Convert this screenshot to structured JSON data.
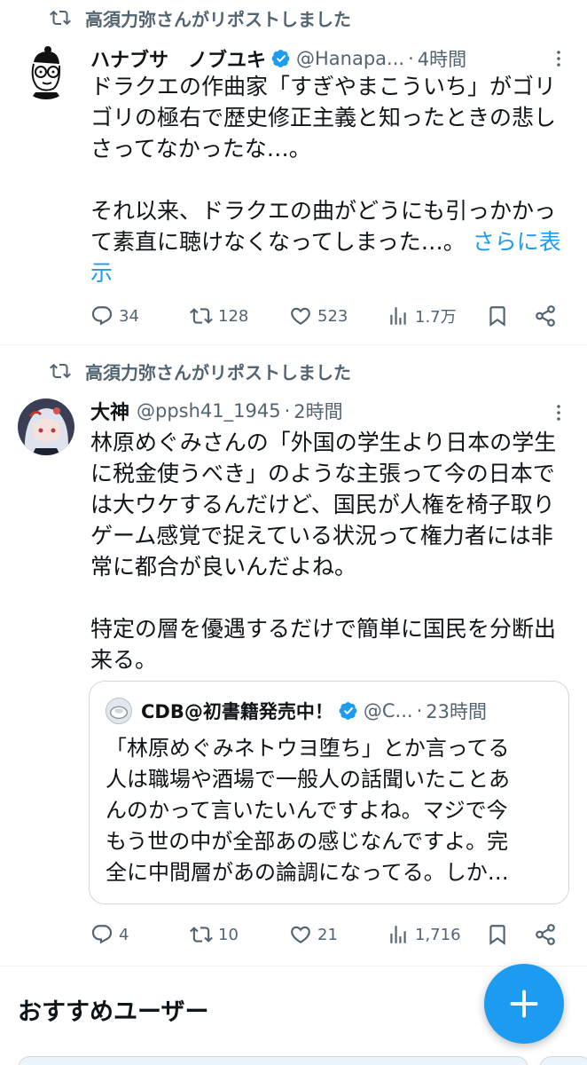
{
  "tweets": [
    {
      "repost_label": "高須力弥さんがリポストしました",
      "name": "ハナブサ　ノブユキ",
      "handle": "@Hanapa...",
      "separator": "·",
      "time": "4時間",
      "body_lines": [
        "ドラクエの作曲家「すぎやまこういち」がゴリ",
        "ゴリの極右で歴史修正主義と知ったときの悲し",
        "さってなかったな…。",
        "",
        "それ以来、ドラクエの曲がどうにも引っかかっ",
        "て素直に聴けなくなってしまった…。"
      ],
      "show_more_part1": "さらに表",
      "show_more_part2": "示",
      "replies": "34",
      "reposts": "128",
      "likes": "523",
      "views": "1.7万"
    },
    {
      "repost_label": "高須力弥さんがリポストしました",
      "name": "大神",
      "handle": "@ppsh41_1945",
      "separator": "·",
      "time": "2時間",
      "body_lines": [
        "林原めぐみさんの「外国の学生より日本の学生",
        "に税金使うべき」のような主張って今の日本で",
        "は大ウケするんだけど、国民が人権を椅子取り",
        "ゲーム感覚で捉えている状況って権力者には非",
        "常に都合が良いんだよね。",
        "",
        "特定の層を優遇するだけで簡単に国民を分断出",
        "来る。"
      ],
      "quote": {
        "name": "CDB@初書籍発売中！",
        "handle": "@C...",
        "separator": "·",
        "time": "23時間",
        "body_lines": [
          "「林原めぐみネトウヨ堕ち」とか言ってる",
          "人は職場や酒場で一般人の話聞いたことあ",
          "んのかって言いたいんですよね。マジで今",
          "もう世の中が全部あの感じなんですよ。完",
          "全に中間層があの論調になってる。しか…"
        ]
      },
      "replies": "4",
      "reposts": "10",
      "likes": "21",
      "views": "1,716"
    }
  ],
  "recommended_title": "おすすめユーザー",
  "fab_icon": "plus-icon",
  "colors": {
    "accent": "#1d9bf0",
    "secondary_text": "#536471",
    "primary_text": "#0f1419",
    "divider": "#eff3f4"
  }
}
